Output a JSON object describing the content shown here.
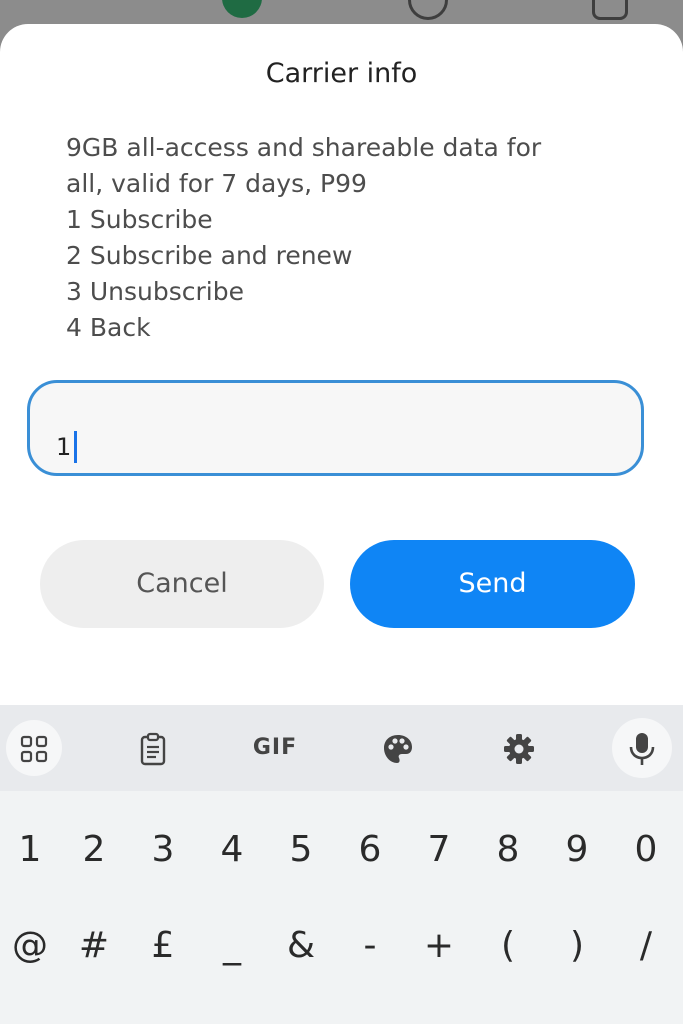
{
  "dialog": {
    "title": "Carrier info",
    "message_lines": [
      "9GB all-access and shareable data for",
      "all, valid for 7 days, P99",
      "1 Subscribe",
      "2 Subscribe and renew",
      "3 Unsubscribe",
      "4 Back"
    ],
    "input_value": "1",
    "cancel_label": "Cancel",
    "send_label": "Send"
  },
  "keyboard": {
    "toolbar": {
      "apps_icon": "grid-icon",
      "clipboard_icon": "clipboard-icon",
      "gif_label": "GIF",
      "theme_icon": "palette-icon",
      "settings_icon": "gear-icon",
      "mic_icon": "microphone-icon"
    },
    "row1": [
      "1",
      "2",
      "3",
      "4",
      "5",
      "6",
      "7",
      "8",
      "9",
      "0"
    ],
    "row2": [
      "@",
      "#",
      "£",
      "_",
      "&",
      "-",
      "+",
      "(",
      ")",
      "/"
    ]
  },
  "colors": {
    "accent": "#0f85f5",
    "input_border": "#3a8fd6"
  }
}
